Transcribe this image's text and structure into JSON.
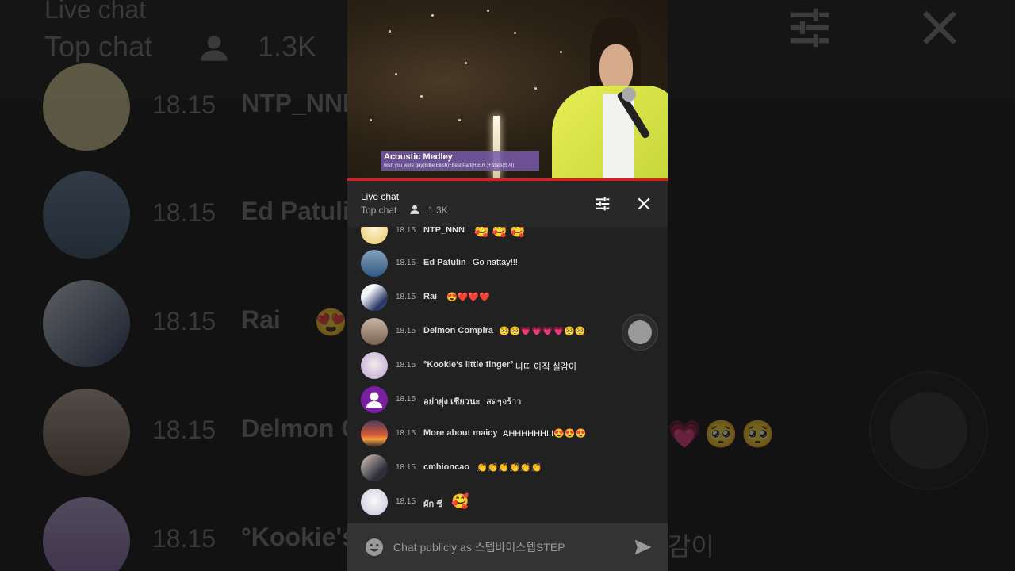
{
  "video": {
    "caption_title": "Acoustic Medley",
    "caption_subtitle": "wish you were gay(Billie Eilish)+Best Part(H.E.R.)+Stars(로시)"
  },
  "header": {
    "title": "Live chat",
    "mode": "Top chat",
    "viewer_count": "1.3K",
    "icons": {
      "filter": "tune-icon",
      "close": "close-icon",
      "viewers": "person-icon"
    }
  },
  "messages": [
    {
      "time": "18.15",
      "author": "NTP_NNN",
      "text": "🥰 🥰 🥰"
    },
    {
      "time": "18.15",
      "author": "Ed Patulin",
      "text": "Go nattay!!!"
    },
    {
      "time": "18.15",
      "author": "Rai",
      "text": "😍❤️❤️❤️"
    },
    {
      "time": "18.15",
      "author": "Delmon Compira",
      "text": "🥺🥺💗💗💗💗🥺🥺"
    },
    {
      "time": "18.15",
      "author": "°Kookie's little finger°",
      "text": "나띠 아직 실감이"
    },
    {
      "time": "18.15",
      "author": "อย่ายุ่ง เชียวนะ",
      "text": "สตๆจร้าา"
    },
    {
      "time": "18.15",
      "author": "More about maicy",
      "text": "AHHHHHH!!!😍😍😍"
    },
    {
      "time": "18.15",
      "author": "cmhioncao",
      "text": "👏👏👏👏👏👏"
    },
    {
      "time": "18.15",
      "author": "ผัก ชี",
      "text": "🥰"
    }
  ],
  "input": {
    "placeholder": "Chat publicly as 스텝바이스텝STEP"
  },
  "background": {
    "title": "Live chat",
    "mode": "Top chat",
    "viewer_count": "1.3K",
    "rows": [
      {
        "time": "18.15",
        "author": "NTP_NNN"
      },
      {
        "time": "18.15",
        "author": "Ed Patuli"
      },
      {
        "time": "18.15",
        "author": "Rai"
      },
      {
        "time": "18.15",
        "author": "Delmon C"
      },
      {
        "time": "18.15",
        "author": "°Kookie's"
      }
    ],
    "side_text": "감이",
    "side_emoji": "💗🥺🥺"
  },
  "colors": {
    "panel": "#212121",
    "header": "#282828",
    "input_bar": "#333333",
    "progress": "#e01b1b",
    "caption_bg": "#785aaa",
    "text_primary": "#ffffff",
    "text_secondary": "#aaaaaa"
  }
}
